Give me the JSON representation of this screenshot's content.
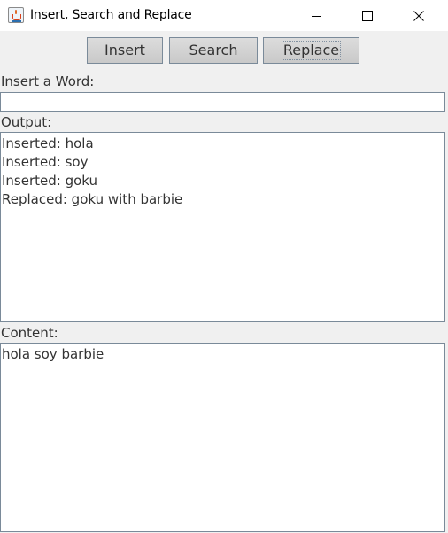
{
  "window": {
    "title": "Insert, Search and Replace",
    "icon": "java-cup-icon"
  },
  "toolbar": {
    "insert_label": "Insert",
    "search_label": "Search",
    "replace_label": "Replace"
  },
  "insert_word": {
    "label": "Insert a Word:",
    "value": ""
  },
  "output": {
    "label": "Output:",
    "lines": [
      "Inserted: hola",
      "Inserted: soy",
      "Inserted: goku",
      "Replaced: goku with barbie"
    ]
  },
  "content": {
    "label": "Content:",
    "text": "hola soy barbie"
  }
}
